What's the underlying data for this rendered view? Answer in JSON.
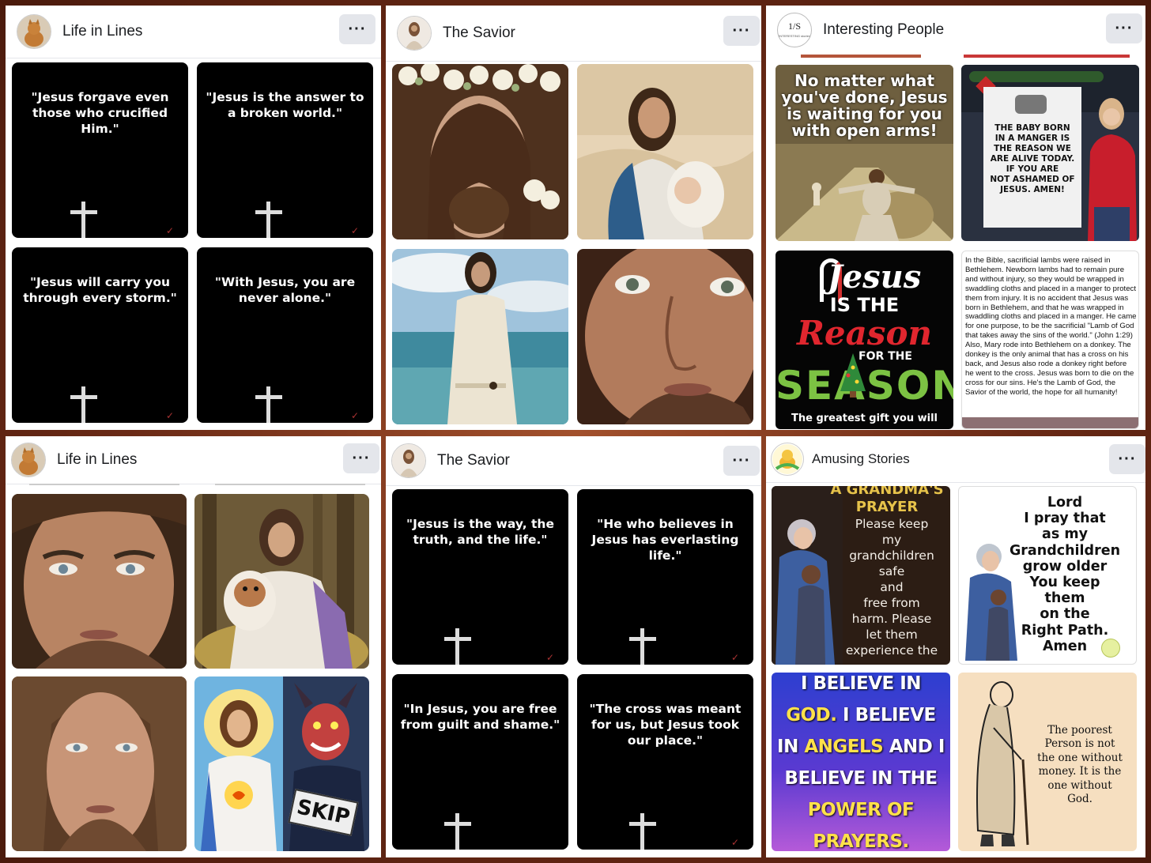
{
  "panels": [
    {
      "page_name": "Life in Lines",
      "more_label": "···",
      "quotes": [
        "\"Jesus forgave even those who crucified Him.\"",
        "\"Jesus is the answer to a broken world.\"",
        "\"Jesus will carry you through every storm.\"",
        "\"With Jesus, you are never alone.\""
      ]
    },
    {
      "page_name": "The Savior",
      "more_label": "···"
    },
    {
      "page_name": "Interesting People",
      "more_label": "···",
      "avatar_logo": {
        "top": "1/S",
        "bottom": "INTERESTING stories"
      },
      "post1_text": "No matter what you've done, Jesus is waiting for you with open arms!",
      "post2_banner": [
        "THE BABY BORN",
        "IN A MANGER IS",
        "THE REASON WE",
        "ARE ALIVE TODAY.",
        "IF YOU ARE",
        "NOT ASHAMED OF",
        "JESUS. AMEN!"
      ],
      "post3": {
        "line1": "Jesus",
        "line2": "IS THE",
        "line3": "Reason",
        "line4": "FOR THE",
        "line5": "SEASON",
        "caption": "The greatest gift you will"
      },
      "post4_text": "In the Bible, sacrificial lambs were raised in Bethlehem. Newborn lambs had to remain pure and without injury, so they would be wrapped in swaddling cloths and placed in a manger to protect them from injury. It is no accident that Jesus was born in Bethlehem, and that he was wrapped in swaddling cloths and placed in a manger. He came for one purpose, to be the sacrificial \"Lamb of God that takes away the sins of the world.\" (John 1:29) Also, Mary rode into Bethlehem on a donkey. The donkey is the only animal that has a cross on his back, and Jesus also rode a donkey right before he went to the cross. Jesus was born to die on the cross for our sins. He's the Lamb of God, the Savior of the world, the hope for all humanity!"
    },
    {
      "page_name": "Life in Lines",
      "more_label": "···",
      "skip_sign": "SKIP"
    },
    {
      "page_name": "The Savior",
      "more_label": "···",
      "quotes": [
        "\"Jesus is the way, the truth, and the life.\"",
        "\"He who believes in Jesus has everlasting life.\"",
        "\"In Jesus, you are free from guilt and shame.\"",
        "\"The cross was meant for us, but Jesus took our place.\""
      ]
    },
    {
      "page_name": "Amusing Stories",
      "more_label": "···",
      "post1": {
        "title": "A GRANDMA'S PRAYER",
        "lines": [
          "Please keep",
          "my",
          "grandchildren",
          "safe",
          "and",
          "free from",
          "harm. Please",
          "let them",
          "experience the"
        ]
      },
      "post2_lines": [
        "Lord",
        "I pray that",
        "as my",
        "Grandchildren",
        "grow older",
        "You keep",
        "them",
        "on the",
        "Right Path.",
        "Amen"
      ],
      "post3_lines": [
        [
          {
            "t": "I BELIEVE IN",
            "c": "#ffffff"
          }
        ],
        [
          {
            "t": "GOD. ",
            "c": "#ffe14a"
          },
          {
            "t": "I BELIEVE",
            "c": "#ffffff"
          }
        ],
        [
          {
            "t": "IN ",
            "c": "#ffffff"
          },
          {
            "t": "ANGELS ",
            "c": "#ffe14a"
          },
          {
            "t": "AND I",
            "c": "#ffffff"
          }
        ],
        [
          {
            "t": "BELIEVE IN THE",
            "c": "#ffffff"
          }
        ],
        [
          {
            "t": "POWER OF",
            "c": "#ffe14a"
          }
        ],
        [
          {
            "t": "PRAYERS.",
            "c": "#ffe14a"
          }
        ]
      ],
      "post4_lines": [
        "The poorest",
        "Person is not",
        "the one without",
        "money. It is the",
        "one without",
        "God."
      ]
    }
  ]
}
